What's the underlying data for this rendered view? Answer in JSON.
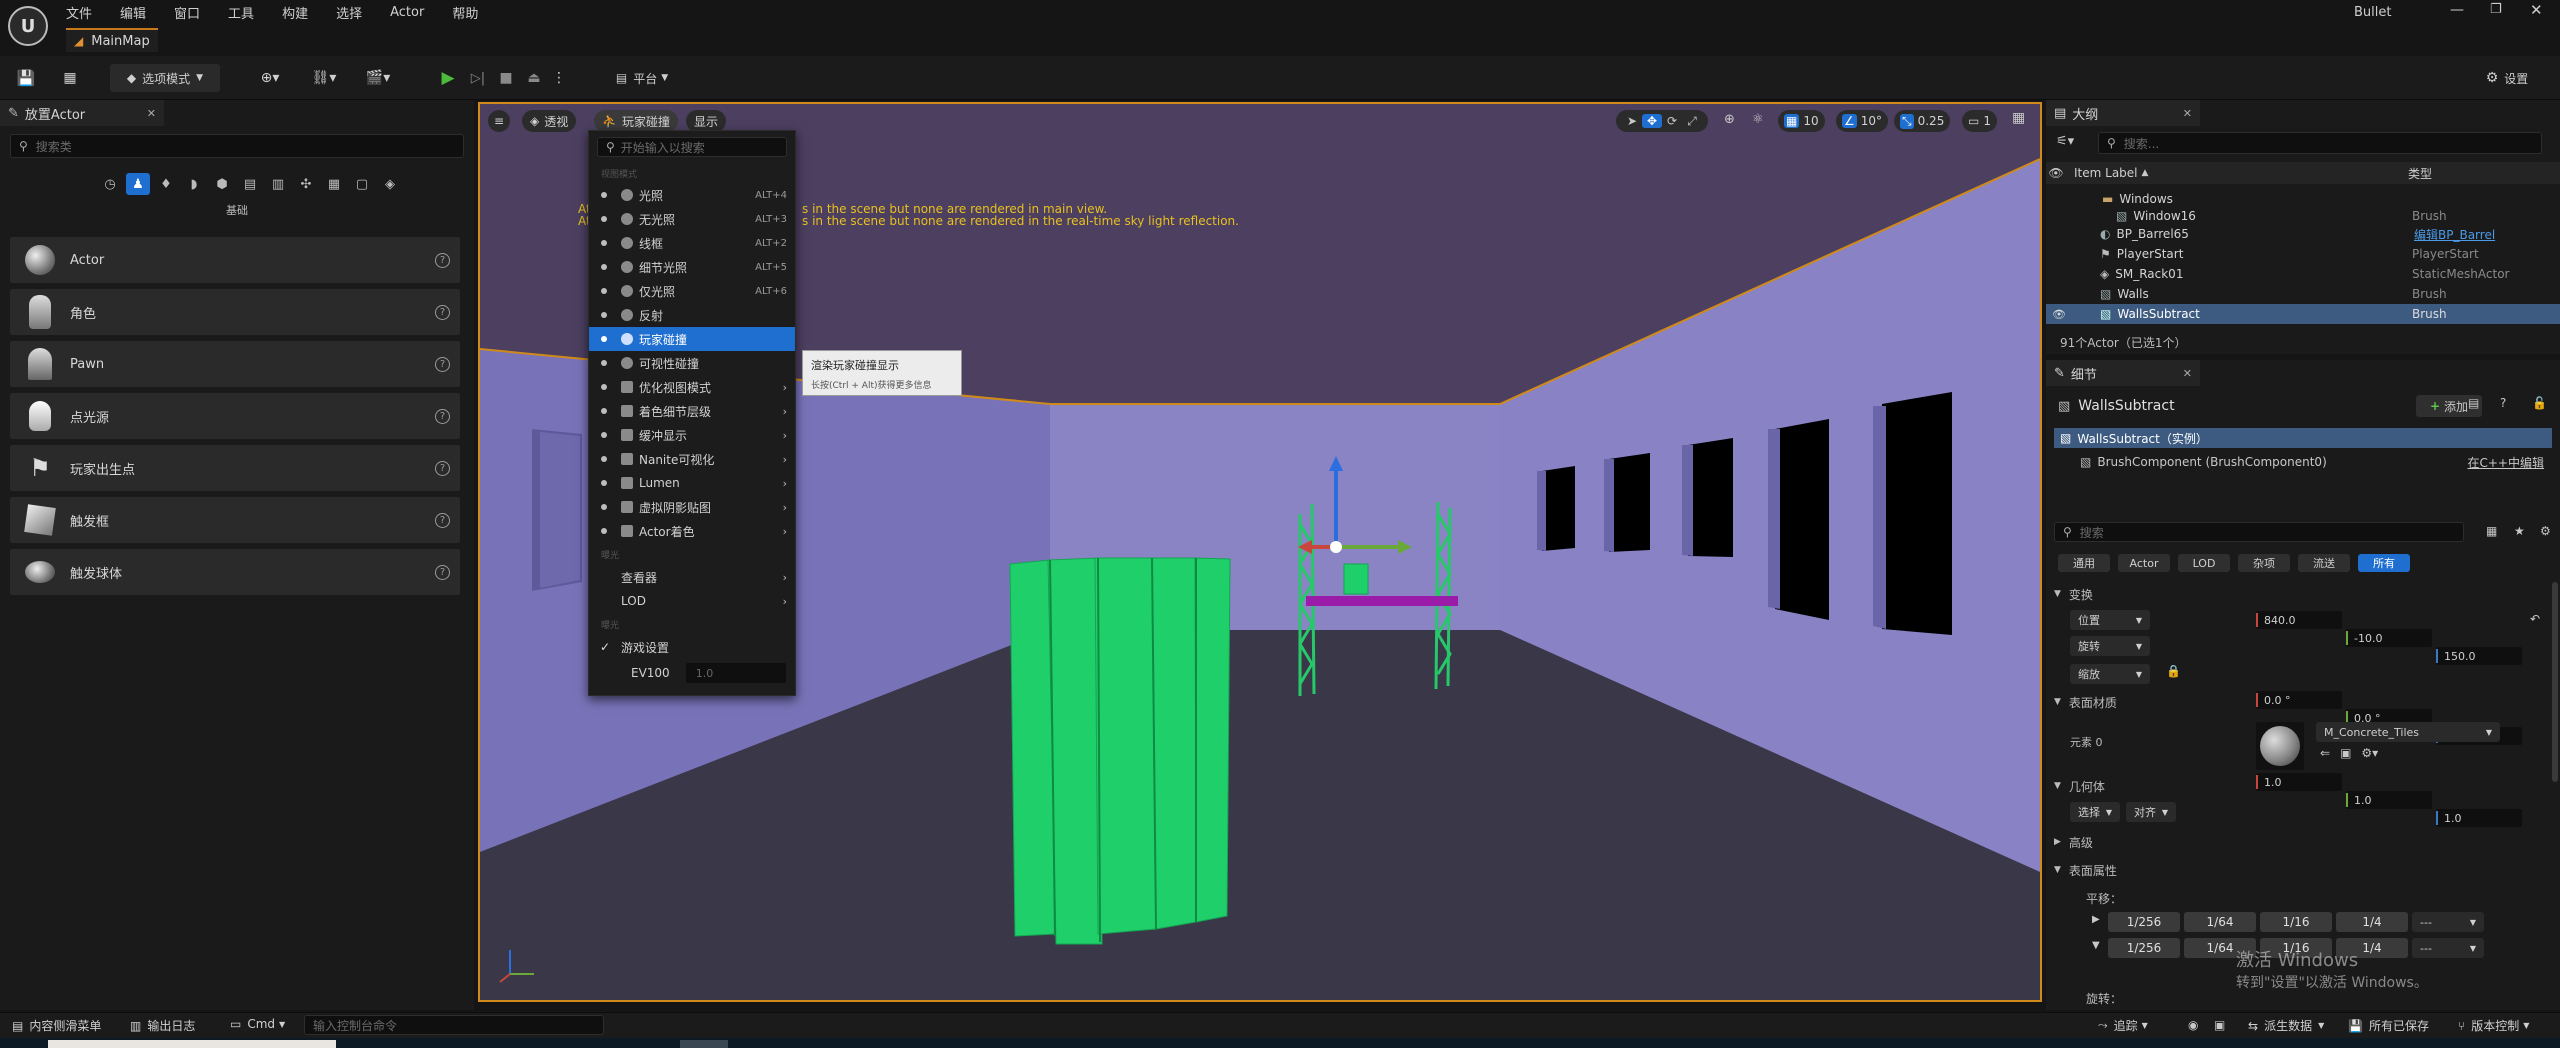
{
  "window": {
    "title": "Bullet",
    "level_tab": "MainMap"
  },
  "menu": [
    "文件",
    "编辑",
    "窗口",
    "工具",
    "构建",
    "选择",
    "Actor",
    "帮助"
  ],
  "toolbar": {
    "mode": "选项模式",
    "platform": "平台",
    "settings": "设置"
  },
  "place_actor": {
    "tab": "放置Actor",
    "search_placeholder": "搜索类",
    "category": "基础",
    "items": [
      "Actor",
      "角色",
      "Pawn",
      "点光源",
      "玩家出生点",
      "触发框",
      "触发球体"
    ]
  },
  "viewport": {
    "perspective": "透视",
    "view_mode": "玩家碰撞",
    "show": "显示",
    "grid_snap": "10",
    "rot_snap": "10°",
    "scale_snap": "0.25",
    "cam_speed": "1",
    "warning1": "At",
    "warning1_tail": "s in the scene but none are rendered in main view.",
    "warning2": "At",
    "warning2_tail": "s in the scene but none are rendered in the real-time sky light reflection.",
    "colors": {
      "walls": "#7d74b8",
      "ceiling": "#4c3f60",
      "floor": "#3a3749",
      "green": "#1fd06a",
      "accent": "#d08a1a"
    }
  },
  "viewmode_menu": {
    "search_placeholder": "开始输入以搜索",
    "section1": "视图模式",
    "items": [
      {
        "label": "光照",
        "shortcut": "ALT+4"
      },
      {
        "label": "无光照",
        "shortcut": "ALT+3"
      },
      {
        "label": "线框",
        "shortcut": "ALT+2"
      },
      {
        "label": "细节光照",
        "shortcut": "ALT+5"
      },
      {
        "label": "仅光照",
        "shortcut": "ALT+6"
      },
      {
        "label": "反射",
        "shortcut": ""
      },
      {
        "label": "玩家碰撞",
        "shortcut": ""
      },
      {
        "label": "可视性碰撞",
        "shortcut": ""
      }
    ],
    "submenus": [
      "优化视图模式",
      "着色细节层级",
      "缓冲显示",
      "Nanite可视化",
      "Lumen",
      "虚拟阴影贴图",
      "Actor着色"
    ],
    "section2": "曝光",
    "submenus2": [
      "查看器",
      "LOD"
    ],
    "section3": "曝光",
    "game_settings": "游戏设置",
    "ev100_label": "EV100",
    "ev100_value": "1.0"
  },
  "tooltip": {
    "title": "渲染玩家碰撞显示",
    "hint": "长按(Ctrl + Alt)获得更多信息"
  },
  "outliner": {
    "tab": "大纲",
    "search_placeholder": "搜索...",
    "col_label": "Item Label",
    "col_type": "类型",
    "rows": [
      {
        "name": "Windows",
        "type": ""
      },
      {
        "name": "Window16",
        "type": "Brush"
      },
      {
        "name": "BP_Barrel65",
        "type": "编辑BP_Barrel"
      },
      {
        "name": "PlayerStart",
        "type": "PlayerStart"
      },
      {
        "name": "SM_Rack01",
        "type": "StaticMeshActor"
      },
      {
        "name": "Walls",
        "type": "Brush"
      },
      {
        "name": "WallsSubtract",
        "type": "Brush"
      }
    ],
    "count": "91个Actor（已选1个）"
  },
  "details": {
    "tab": "细节",
    "object": "WallsSubtract",
    "add": "添加",
    "instance": "WallsSubtract（实例）",
    "component": "BrushComponent (BrushComponent0)",
    "cpp_link": "在C++中编辑",
    "search_placeholder": "搜索",
    "filters": [
      "通用",
      "Actor",
      "LOD",
      "杂项",
      "流送",
      "所有"
    ],
    "transform": "变换",
    "location_label": "位置",
    "location": [
      "840.0",
      "-10.0",
      "150.0"
    ],
    "rotation_label": "旋转",
    "rotation": [
      "0.0 °",
      "0.0 °",
      "0.0 °"
    ],
    "scale_label": "缩放",
    "scale": [
      "1.0",
      "1.0",
      "1.0"
    ],
    "surface_material": "表面材质",
    "element": "元素 0",
    "material": "M_Concrete_Tiles",
    "geometry": "几何体",
    "select": "选择",
    "align": "对齐",
    "advanced": "高级",
    "surface_props": "表面属性",
    "pan": "平移：",
    "fractions": [
      "1/256",
      "1/64",
      "1/16",
      "1/4"
    ],
    "dash": "---",
    "activate1": "激活 Windows",
    "activate2": "转到\"设置\"以激活 Windows。",
    "rotate_label": "旋转："
  },
  "statusbar": {
    "content_drawer": "内容侧滑菜单",
    "output_log": "输出日志",
    "cmd": "Cmd",
    "console_placeholder": "输入控制台命令",
    "trace": "追踪",
    "derived": "派生数据",
    "save_all": "所有已保存",
    "revision": "版本控制"
  }
}
